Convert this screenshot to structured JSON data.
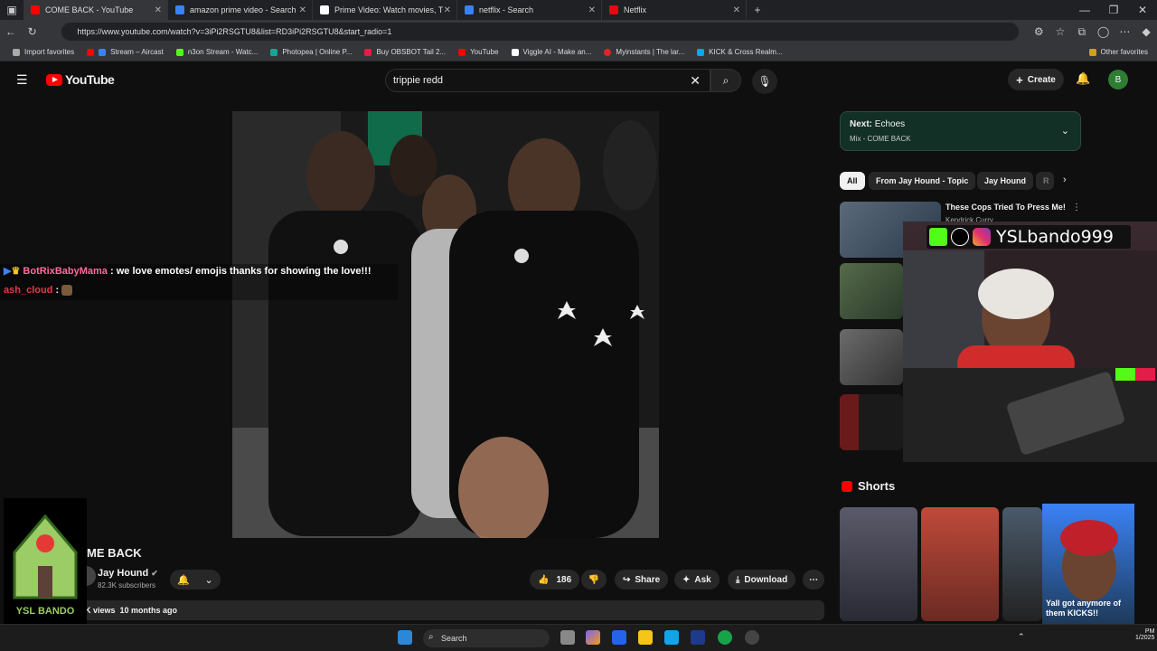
{
  "browser": {
    "tabs": [
      {
        "label": "COME BACK - YouTube",
        "active": true,
        "color": "#ff0000"
      },
      {
        "label": "amazon prime video - Search",
        "active": false,
        "color": "#3b82f6"
      },
      {
        "label": "Prime Video: Watch movies, TV sh",
        "active": false,
        "color": "#ffffff"
      },
      {
        "label": "netflix - Search",
        "active": false,
        "color": "#3b82f6"
      },
      {
        "label": "Netflix",
        "active": false,
        "color": "#e50914"
      }
    ],
    "url": "https://www.youtube.com/watch?v=3iPi2RSGTU8&list=RD3iPi2RSGTU8&start_radio=1",
    "bookmarks": [
      {
        "label": "Import favorites",
        "color": "#aaaaaa"
      },
      {
        "label": "Stream – Aircast",
        "color": "#3b82f6"
      },
      {
        "label": "n3on Stream - Watc...",
        "color": "#53fc18"
      },
      {
        "label": "Photopea | Online P...",
        "color": "#18a497"
      },
      {
        "label": "Buy OBSBOT Tail 2...",
        "color": "#e11d48"
      },
      {
        "label": "YouTube",
        "color": "#ff0000"
      },
      {
        "label": "Viggle AI - Make an...",
        "color": "#ffffff"
      },
      {
        "label": "Myinstants | The lar...",
        "color": "#dc2626"
      },
      {
        "label": "KICK & Cross Realm...",
        "color": "#0ea5e9"
      }
    ],
    "other_favorites": "Other favorites"
  },
  "youtube": {
    "logo_text": "YouTube",
    "search_value": "trippie redd",
    "create_label": "Create",
    "avatar_letter": "B",
    "video": {
      "title": "ME BACK",
      "channel": "Jay Hound",
      "subscribers": "82.3K subscribers",
      "likes": "186",
      "share": "Share",
      "ask": "Ask",
      "download": "Download",
      "views": "K views",
      "age": "10 months ago"
    },
    "next": {
      "label": "Next:",
      "title": "Echoes",
      "mix": "Mix - COME BACK"
    },
    "chips": [
      "All",
      "From Jay Hound - Topic",
      "Jay Hound",
      "R"
    ],
    "recommended": [
      {
        "title": "These Cops Tried To Press Me!",
        "channel": "Kendrick Curry"
      }
    ],
    "shorts_title": "Shorts"
  },
  "chat": {
    "messages": [
      {
        "user": "BotRixBabyMama",
        "text": "we love emotes/ emojis thanks for showing the love!!!",
        "user_color": "#ff6b9d"
      },
      {
        "user": "ash_cloud",
        "text": "",
        "user_color": "#e0394b"
      }
    ]
  },
  "stream_overlay": {
    "handle": "YSLbando999",
    "webcam_caption": "Yall got anymore of them KICKS!!",
    "logo_text": "YSL BANDO"
  },
  "taskbar": {
    "search_placeholder": "Search",
    "time": "PM",
    "date": "1/2025"
  }
}
